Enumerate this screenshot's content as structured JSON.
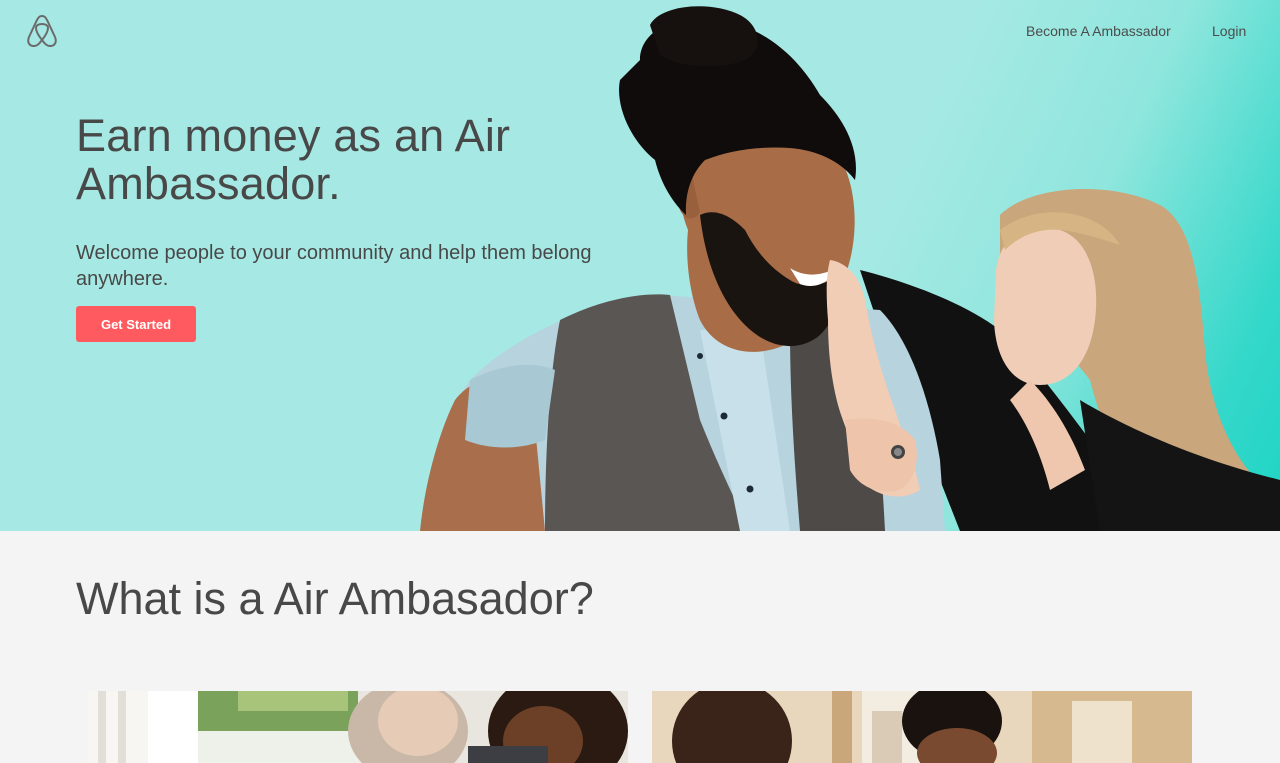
{
  "nav": {
    "logo_icon": "airbnb-belo-logo",
    "become_ambassador": "Become A Ambassador",
    "login": "Login"
  },
  "hero": {
    "title": "Earn money as an Air Ambassador.",
    "subtitle": "Welcome people to your community and help them belong anywhere.",
    "cta_label": "Get Started",
    "background_color": "#a6e9e4",
    "accent_color": "#1ed4c4"
  },
  "section": {
    "title": "What is a Air Ambasador?"
  },
  "colors": {
    "brand": "#ff5a5f",
    "text": "#484848",
    "page_background": "#f4f4f4"
  }
}
